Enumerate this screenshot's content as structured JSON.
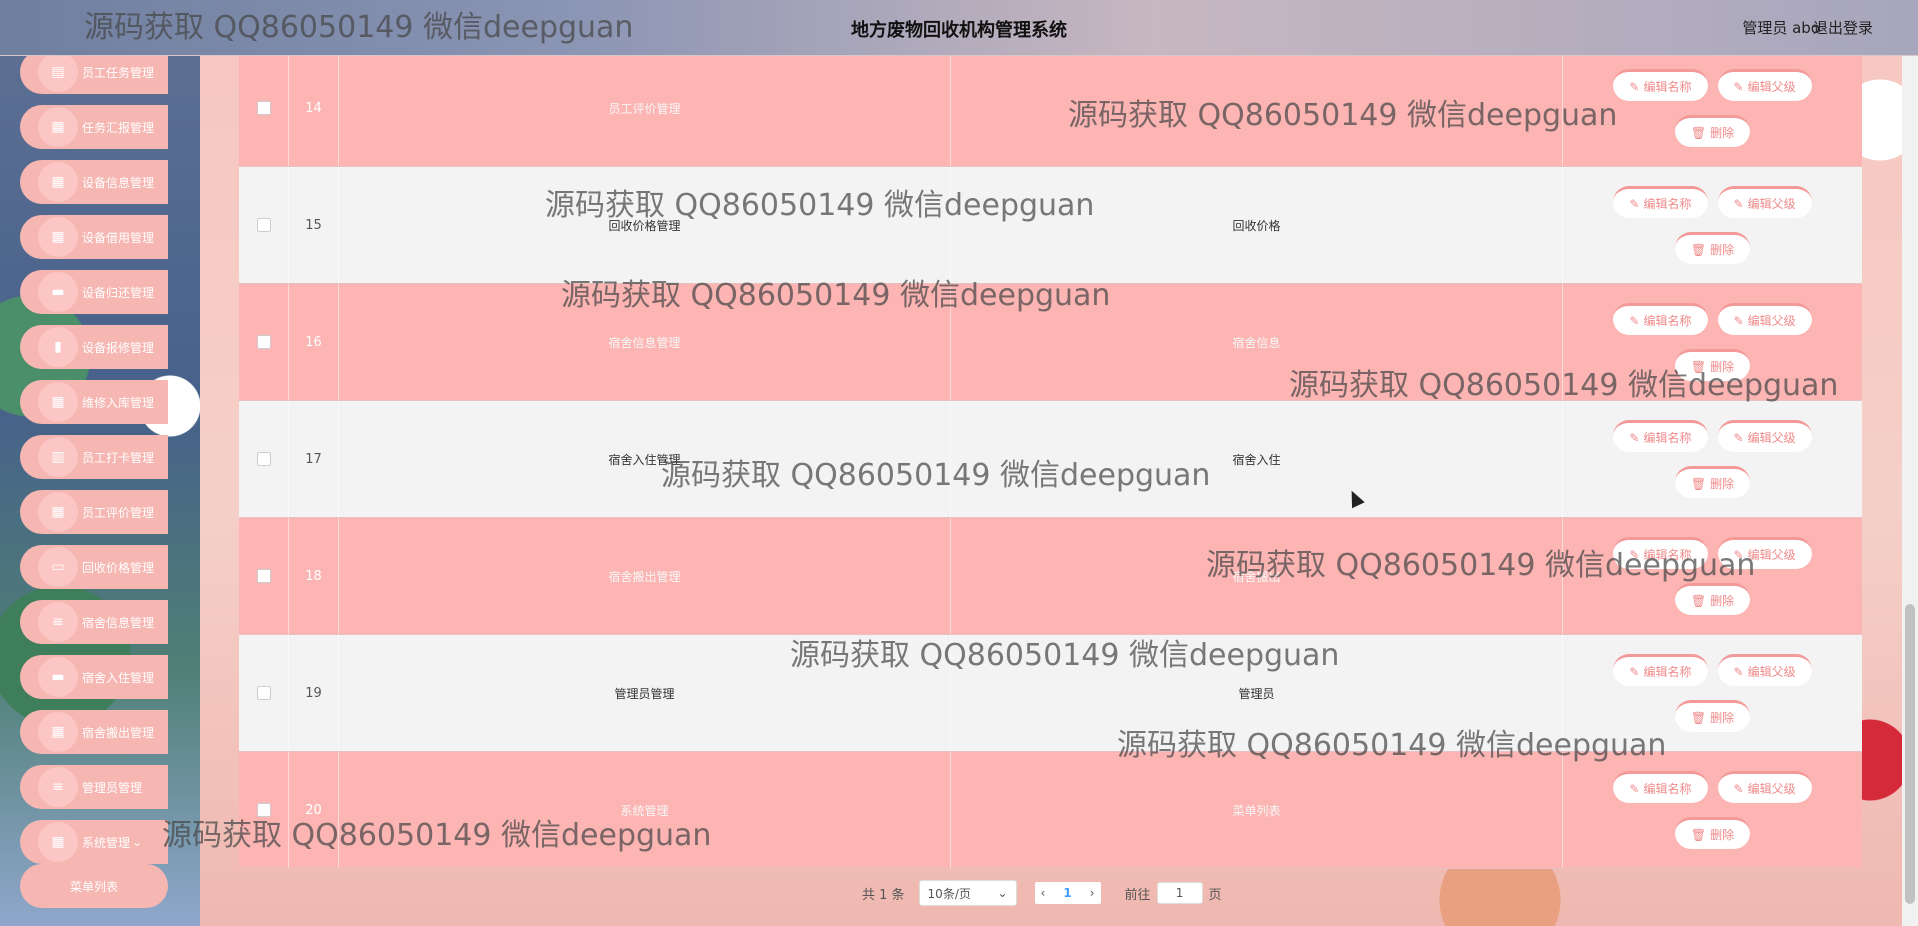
{
  "header": {
    "title": "地方废物回收机构管理系统",
    "user": "管理员 abo",
    "logout": "退出登录"
  },
  "sidebar": {
    "items": [
      {
        "label": "员工任务管理",
        "icon": "clipboard-icon"
      },
      {
        "label": "任务汇报管理",
        "icon": "grid-icon"
      },
      {
        "label": "设备信息管理",
        "icon": "grid-icon"
      },
      {
        "label": "设备借用管理",
        "icon": "grid-icon"
      },
      {
        "label": "设备归还管理",
        "icon": "chat-icon"
      },
      {
        "label": "设备报修管理",
        "icon": "chart-icon"
      },
      {
        "label": "维修入库管理",
        "icon": "grid-icon"
      },
      {
        "label": "员工打卡管理",
        "icon": "bar-chart-icon"
      },
      {
        "label": "员工评价管理",
        "icon": "table-icon"
      },
      {
        "label": "回收价格管理",
        "icon": "monitor-icon"
      },
      {
        "label": "宿舍信息管理",
        "icon": "list-icon"
      },
      {
        "label": "宿舍入住管理",
        "icon": "chat-icon"
      },
      {
        "label": "宿舍搬出管理",
        "icon": "grid-icon"
      },
      {
        "label": "管理员管理",
        "icon": "list-icon"
      },
      {
        "label": "系统管理",
        "icon": "grid-icon"
      }
    ],
    "sub_item": "菜单列表"
  },
  "table": {
    "buttons": {
      "edit_name": "编辑名称",
      "edit_parent": "编辑父级",
      "delete": "删除"
    },
    "rows": [
      {
        "index": "14",
        "name": "员工评价管理",
        "parent": ""
      },
      {
        "index": "15",
        "name": "回收价格管理",
        "parent": "回收价格"
      },
      {
        "index": "16",
        "name": "宿舍信息管理",
        "parent": "宿舍信息"
      },
      {
        "index": "17",
        "name": "宿舍入住管理",
        "parent": "宿舍入住"
      },
      {
        "index": "18",
        "name": "宿舍搬出管理",
        "parent": "宿舍搬出"
      },
      {
        "index": "19",
        "name": "管理员管理",
        "parent": "管理员"
      },
      {
        "index": "20",
        "name": "系统管理",
        "parent": "菜单列表"
      }
    ]
  },
  "pagination": {
    "total": "共 1 条",
    "page_size": "10条/页",
    "current_page": "1",
    "goto_label": "前往",
    "goto_value": "1",
    "page_unit": "页"
  },
  "watermark": "源码获取 QQ86050149 微信deepguan",
  "colors": {
    "row_pink": "#fcb5b3",
    "row_grey": "#f3f3f3",
    "button_text": "#f08a8a",
    "menu_bg": "#f6b6b2"
  }
}
